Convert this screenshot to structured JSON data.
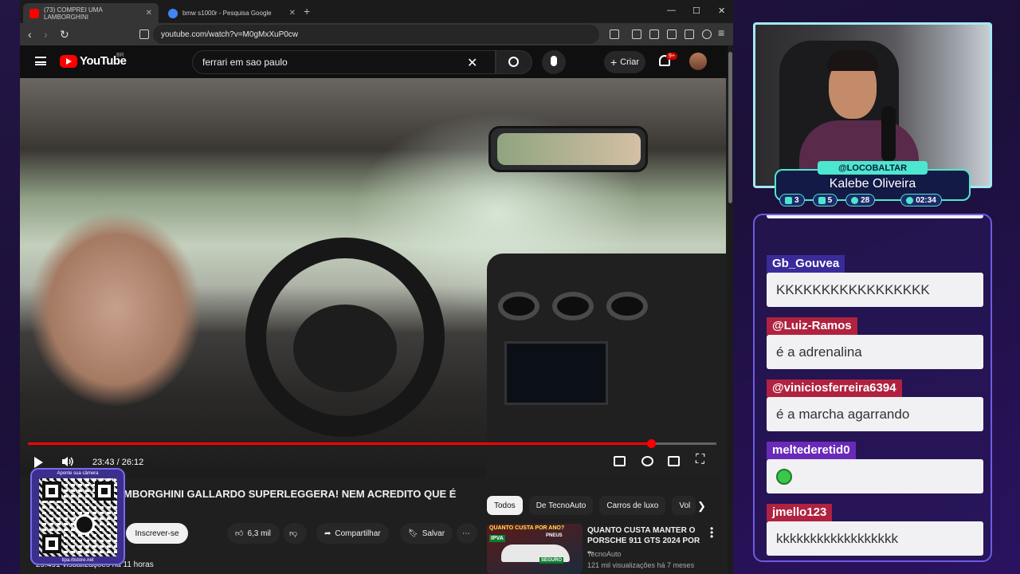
{
  "browser": {
    "tabs": [
      {
        "title": "(73) COMPREI UMA LAMBORGHINI",
        "active": true,
        "icon_color": "#ff0000"
      },
      {
        "title": "bmw s1000r - Pesquisa Google",
        "active": false,
        "icon_color": "#4285f4"
      }
    ],
    "url": "youtube.com/watch?v=M0gMxXuP0cw"
  },
  "youtube": {
    "region": "BR",
    "search_query": "ferrari em sao paulo",
    "create_label": "Criar",
    "notif_count": "9+",
    "logo_text": "YouTube"
  },
  "player": {
    "current_time": "23:43",
    "duration": "26:12",
    "time_display": "23:43 / 26:12",
    "progress": 0.9052
  },
  "video": {
    "title": "MBORGHINI GALLARDO SUPERLEGGERA! NEM ACREDITO QUE É",
    "subscribe_label": "Inscrever-se",
    "likes": "6,3 mil",
    "share_label": "Compartilhar",
    "save_label": "Salvar",
    "views": "29.491 visualizações  há 11 horas"
  },
  "recommend": {
    "chips": [
      "Todos",
      "De TecnoAuto",
      "Carros de luxo",
      "Vol"
    ],
    "item": {
      "title": "QUANTO CUSTA MANTER O PORSCHE 911 GTS 2024 POR ...",
      "channel": "TecnoAuto",
      "meta": "121 mil visualizações  há 7 meses",
      "thumb_top": "QUANTO CUSTA POR ANO?",
      "thumb_ipva": "IPVA",
      "thumb_pneus": "PNEUS",
      "thumb_seguro": "SEGURO"
    }
  },
  "qr_overlay": {
    "caption": "Aponte sua câmera",
    "footer": "tipa.rbstore.net"
  },
  "stream": {
    "handle": "@LOCOBALTAR",
    "name": "Kalebe Oliveira",
    "stats": [
      "3",
      "5",
      "28",
      "02:34"
    ],
    "accent": "#4de6cf"
  },
  "chat": [
    {
      "user": "Gb_Gouvea",
      "text": "KKKKKKKKKKKKKKKKK",
      "color": "#3a2b9a"
    },
    {
      "user": "@Luiz-Ramos",
      "text": "é a adrenalina",
      "color": "#b0223f"
    },
    {
      "user": "@viniciosferreira6394",
      "text": "é a marcha agarrando",
      "color": "#b0223f"
    },
    {
      "user": "meltederetid0",
      "text": "",
      "color": "#6a2ab8"
    },
    {
      "user": "jmello123",
      "text": "kkkkkkkkkkkkkkkkkk",
      "color": "#b0223f"
    }
  ]
}
